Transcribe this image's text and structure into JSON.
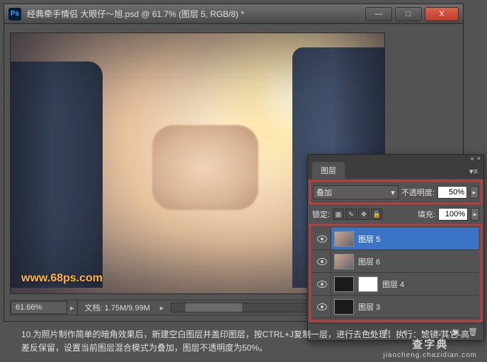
{
  "window": {
    "title": "经典牵手情侣   大眼仔～旭.psd @ 61.7% (图层 5, RGB/8) *",
    "controls": {
      "min": "—",
      "max": "□",
      "close": "X"
    }
  },
  "watermark": "www.68ps.com",
  "statusbar": {
    "zoom": "61.66%",
    "docinfo_label": "文档:",
    "docinfo_value": "1.75M/9.99M"
  },
  "layers_panel": {
    "tab_label": "图层",
    "blend_mode": "叠加",
    "opacity_label": "不透明度:",
    "opacity_value": "50%",
    "lock_label": "锁定:",
    "fill_label": "填充:",
    "fill_value": "100%",
    "layers": [
      {
        "name": "图层 5",
        "selected": true,
        "thumb": "photo"
      },
      {
        "name": "图层 6",
        "selected": false,
        "thumb": "photo"
      },
      {
        "name": "图层 4",
        "selected": false,
        "thumb": "dark",
        "mask": true
      },
      {
        "name": "图层 3",
        "selected": false,
        "thumb": "dark"
      }
    ]
  },
  "caption": "10.为照片制作简单的暗角效果后，新建空白图层并盖印图层，按CTRL+J复制一层，进行去色处理，执行：滤镜-其它-高差反保留，设置当前图层混合模式为叠加，图层不透明度为50%。",
  "badge": {
    "line1": "查字典",
    "line2": "jiaocheng.chazidian.com"
  }
}
